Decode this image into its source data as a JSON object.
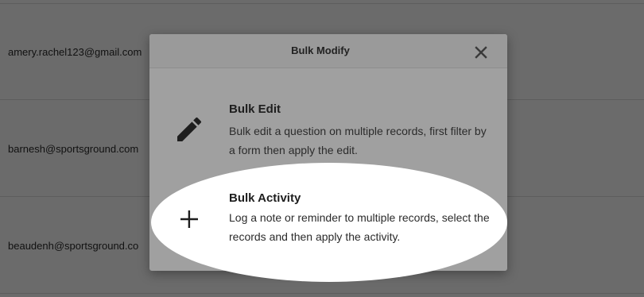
{
  "background_rows": [
    {
      "email": "amery.rachel123@gmail.com"
    },
    {
      "email": "barnesh@sportsground.com"
    },
    {
      "email": "beaudenh@sportsground.co"
    }
  ],
  "modal": {
    "title": "Bulk Modify",
    "close_icon": "close-icon",
    "options": [
      {
        "icon": "pencil-icon",
        "title": "Bulk Edit",
        "description": "Bulk edit a question on multiple records, first filter by a form then apply the edit."
      },
      {
        "icon": "plus-icon",
        "title": "Bulk Activity",
        "description": "Log a note or reminder to multiple records, select the records and then apply the activity."
      }
    ]
  },
  "colors": {
    "backdrop": "#6b6b6b",
    "modal_body": "#a0a0a0",
    "modal_header": "#9a9a9a",
    "spotlight": "#ffffff",
    "text": "#222222"
  }
}
